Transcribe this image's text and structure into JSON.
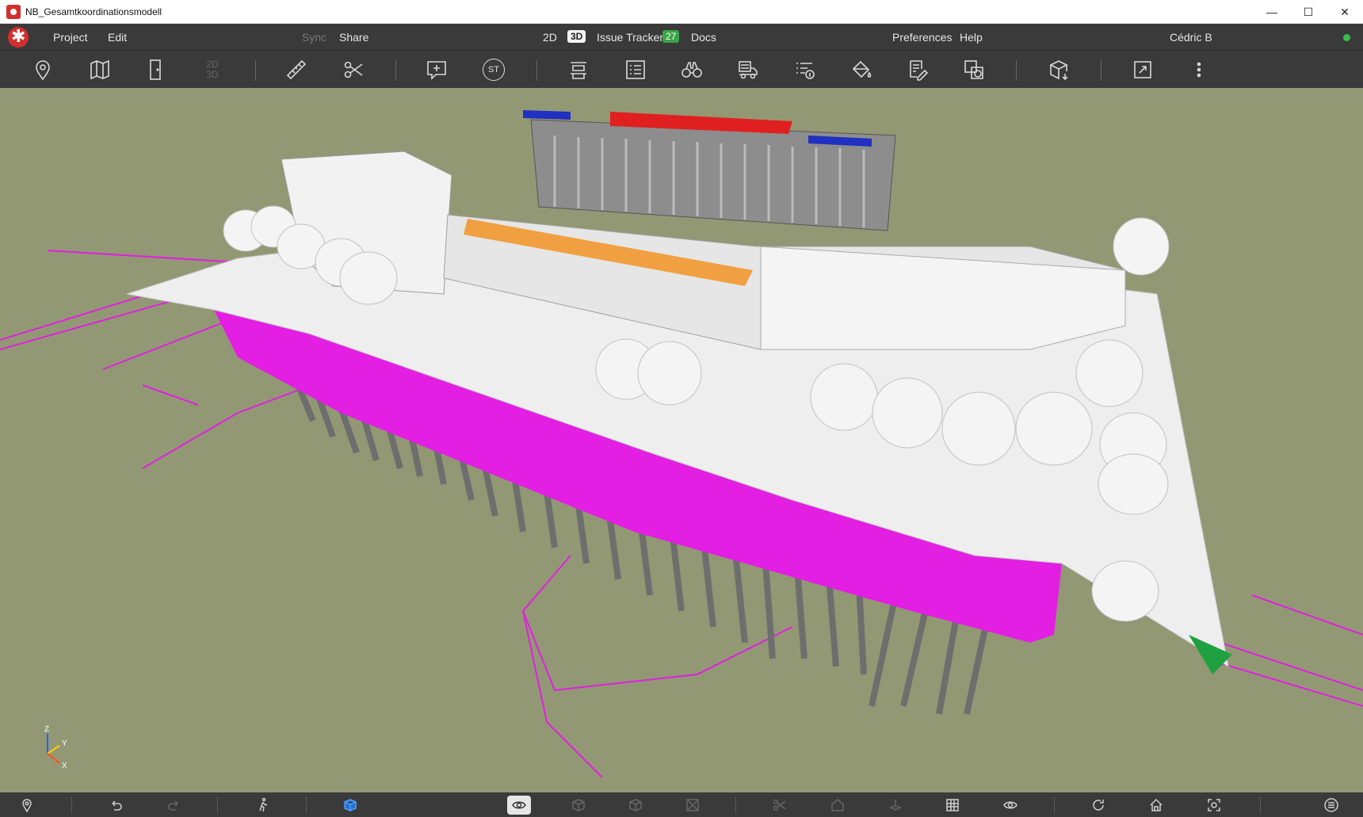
{
  "window": {
    "title": "NB_Gesamtkoordinationsmodell",
    "controls": [
      "—",
      "☐",
      "✕"
    ]
  },
  "menubar": {
    "project": "Project",
    "edit": "Edit",
    "sync": "Sync",
    "share": "Share",
    "mode_2d": "2D",
    "mode_3d": "3D",
    "issue_tracker": "Issue Tracker",
    "issue_count": "27",
    "docs": "Docs",
    "preferences": "Preferences",
    "help": "Help",
    "user": "Cédric B",
    "status_color": "#36c24a"
  },
  "toolbar": {
    "toggle_2d": "2D",
    "toggle_3d": "3D",
    "stamp_label": "ST",
    "icons": [
      "location-pin-icon",
      "map-pin-icon",
      "door-icon",
      "2d-3d-toggle",
      "ruler-icon",
      "scissors-icon",
      "add-comment-icon",
      "stamp-icon",
      "layers-icon",
      "list-icon",
      "binoculars-icon",
      "vehicle-icon",
      "info-list-icon",
      "paint-bucket-icon",
      "edit-doc-icon",
      "annotation-icon",
      "box-measure-icon",
      "expand-icon",
      "more-icon"
    ]
  },
  "viewport": {
    "background": "#939874",
    "axis_labels": {
      "z": "Z",
      "y": "Y",
      "x": "X"
    }
  },
  "bottombar": {
    "icons": [
      "location-pin-icon",
      "undo-icon",
      "redo-icon",
      "walk-icon",
      "cube-icon",
      "eye-icon",
      "box-outline-icon",
      "box-icon",
      "frame-icon",
      "scissors-icon",
      "house-outline-icon",
      "pin-3d-icon",
      "grid-icon",
      "eye-settings-icon",
      "rotate-icon",
      "home-icon",
      "focus-icon",
      "list-icon"
    ]
  }
}
